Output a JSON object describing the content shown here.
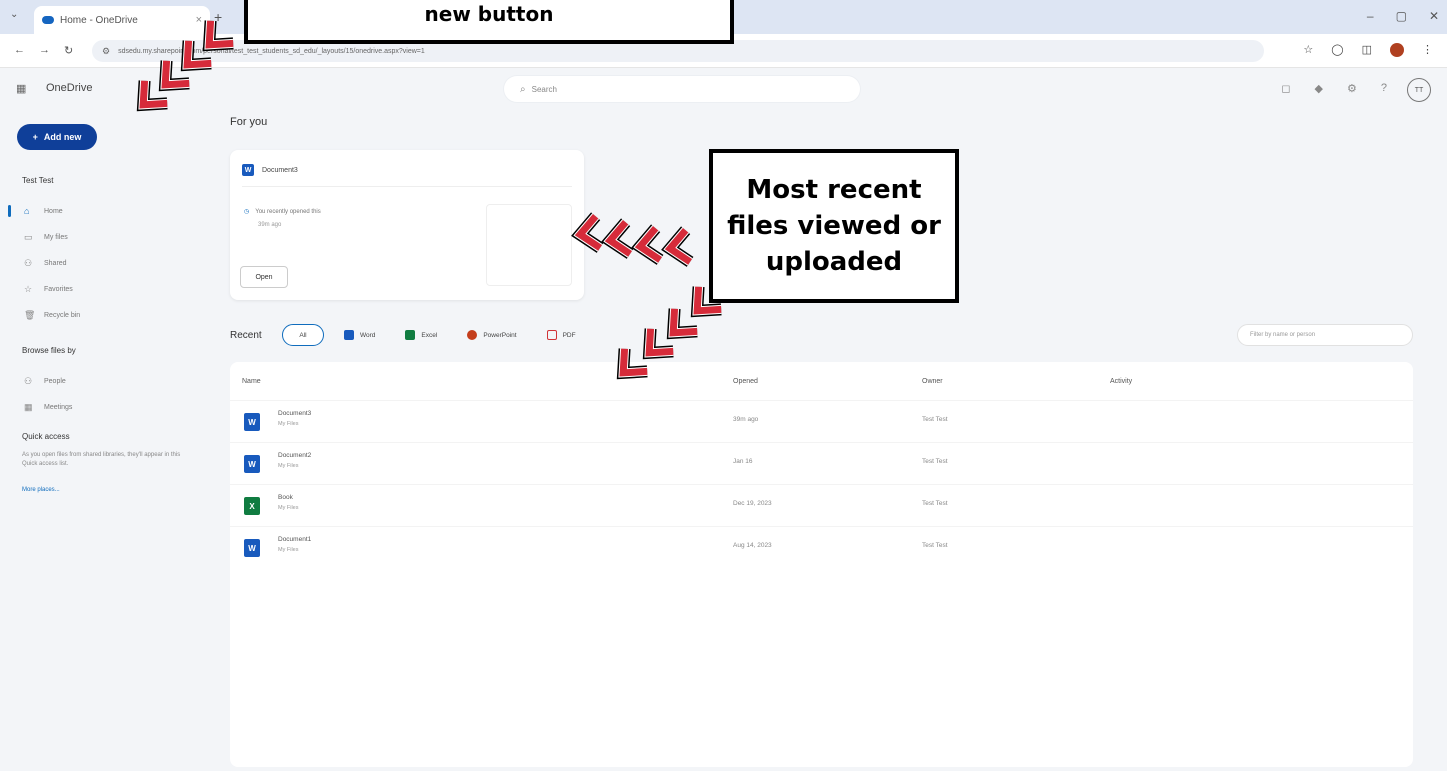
{
  "browser": {
    "tab_title": "Home - OneDrive",
    "tab_close": "×",
    "new_tab": "+",
    "tab_menu": "⌄",
    "window_controls": [
      "–",
      "▢",
      "✕"
    ],
    "nav_buttons": [
      "←",
      "→",
      "↻"
    ],
    "url": "sdsedu.my.sharepoint.com/personal/test_test_students_sd_edu/_layouts/15/onedrive.aspx?view=1"
  },
  "app": {
    "name": "OneDrive",
    "search_placeholder": "Search",
    "avatar_initials": "TT"
  },
  "sidebar": {
    "add_new": "Add new",
    "user": "Test Test",
    "nav_items": [
      {
        "label": "Home",
        "icon": "home-icon",
        "glyph": "⌂"
      },
      {
        "label": "My files",
        "icon": "folder-icon",
        "glyph": "▭"
      },
      {
        "label": "Shared",
        "icon": "people-icon",
        "glyph": "⚇"
      },
      {
        "label": "Favorites",
        "icon": "star-icon",
        "glyph": "☆"
      },
      {
        "label": "Recycle bin",
        "icon": "trash-icon",
        "glyph": "🗑"
      }
    ],
    "browse_heading": "Browse files by",
    "browse_items": [
      {
        "label": "People",
        "icon": "person-icon",
        "glyph": "⚇"
      },
      {
        "label": "Meetings",
        "icon": "calendar-icon",
        "glyph": "▦"
      }
    ],
    "quick_access_heading": "Quick access",
    "quick_access_text": "As you open files from shared libraries, they'll appear in this Quick access list.",
    "more_places": "More places..."
  },
  "main": {
    "for_you_heading": "For you",
    "for_you_card": {
      "doc_name": "Document3",
      "reason": "You recently opened this",
      "time": "39m ago",
      "open_button": "Open"
    },
    "recent_heading": "Recent",
    "filters": [
      {
        "label": "All",
        "color": "#0f6cbd"
      },
      {
        "label": "Word",
        "color": "#185abd"
      },
      {
        "label": "Excel",
        "color": "#107c41"
      },
      {
        "label": "PowerPoint",
        "color": "#c43e1c"
      },
      {
        "label": "PDF",
        "color": "#d13438"
      }
    ],
    "filter_placeholder": "Filter by name or person",
    "columns": [
      "Name",
      "Opened",
      "Owner",
      "Activity"
    ],
    "files": [
      {
        "name": "Document3",
        "location": "My Files",
        "opened": "39m ago",
        "owner": "Test Test",
        "type": "word"
      },
      {
        "name": "Document2",
        "location": "My Files",
        "opened": "Jan 16",
        "owner": "Test Test",
        "type": "word"
      },
      {
        "name": "Book",
        "location": "My Files",
        "opened": "Dec 19, 2023",
        "owner": "Test Test",
        "type": "excel"
      },
      {
        "name": "Document1",
        "location": "My Files",
        "opened": "Aug 14, 2023",
        "owner": "Test Test",
        "type": "word"
      }
    ]
  },
  "callouts": {
    "top": "new button",
    "middle_lines": [
      "Most recent",
      "files viewed or",
      "uploaded"
    ]
  },
  "colors": {
    "word": "#185abd",
    "excel": "#107c41",
    "accent": "#0f3f99",
    "arrow": "#d62b3a"
  }
}
